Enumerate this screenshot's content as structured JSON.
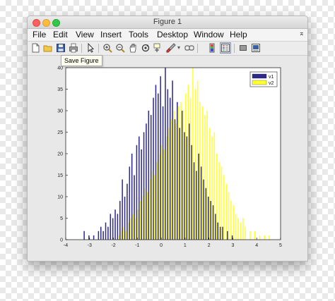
{
  "window": {
    "title": "Figure 1"
  },
  "menu": [
    "File",
    "Edit",
    "View",
    "Insert",
    "Tools",
    "Desktop",
    "Window",
    "Help"
  ],
  "menu_overflow": "⌅",
  "toolbar": {
    "icons": [
      "new-figure-icon",
      "open-file-icon",
      "save-icon",
      "print-icon",
      "pointer-icon",
      "zoom-in-icon",
      "zoom-out-icon",
      "pan-icon",
      "rotate-3d-icon",
      "data-cursor-icon",
      "brush-icon",
      "brush-dropdown-icon",
      "link-plot-icon",
      "insert-colorbar-icon",
      "insert-legend-icon",
      "hide-plot-tools-icon",
      "show-plot-tools-icon"
    ]
  },
  "tooltip": "Save Figure",
  "colors": {
    "v1": "#2d2a8c",
    "v2": "#ffff33"
  },
  "chart_data": {
    "type": "bar",
    "title": "",
    "xlabel": "",
    "ylabel": "",
    "xlim": [
      -4,
      5
    ],
    "ylim": [
      0,
      40
    ],
    "xticks": [
      -4,
      -3,
      -2,
      -1,
      0,
      1,
      2,
      3,
      4,
      5
    ],
    "yticks": [
      0,
      5,
      10,
      15,
      20,
      25,
      30,
      35,
      40
    ],
    "legend_position": "top-right",
    "grid": false,
    "series": [
      {
        "name": "v1",
        "color": "#2d2a8c",
        "x": [
          -3.2,
          -3.0,
          -2.8,
          -2.6,
          -2.5,
          -2.4,
          -2.3,
          -2.2,
          -2.1,
          -2.0,
          -1.9,
          -1.8,
          -1.7,
          -1.6,
          -1.5,
          -1.4,
          -1.3,
          -1.2,
          -1.1,
          -1.0,
          -0.9,
          -0.8,
          -0.7,
          -0.6,
          -0.5,
          -0.4,
          -0.3,
          -0.2,
          -0.1,
          0.0,
          0.1,
          0.2,
          0.3,
          0.4,
          0.5,
          0.6,
          0.7,
          0.8,
          0.9,
          1.0,
          1.1,
          1.2,
          1.3,
          1.4,
          1.5,
          1.6,
          1.7,
          1.8,
          1.9,
          2.0,
          2.1,
          2.2,
          2.3,
          2.4,
          2.5,
          2.6,
          2.8,
          3.0
        ],
        "values": [
          2,
          1,
          1,
          2,
          3,
          2,
          4,
          3,
          6,
          5,
          7,
          6,
          9,
          14,
          10,
          13,
          17,
          20,
          15,
          22,
          24,
          21,
          25,
          27,
          30,
          29,
          33,
          36,
          34,
          38,
          31,
          40,
          35,
          33,
          37,
          28,
          32,
          26,
          30,
          25,
          24,
          27,
          22,
          18,
          16,
          20,
          17,
          14,
          12,
          10,
          9,
          8,
          6,
          4,
          3,
          3,
          2,
          1
        ]
      },
      {
        "name": "v2",
        "color": "#ffff33",
        "x": [
          -1.8,
          -1.7,
          -1.6,
          -1.5,
          -1.4,
          -1.3,
          -1.2,
          -1.1,
          -1.0,
          -0.9,
          -0.8,
          -0.7,
          -0.6,
          -0.5,
          -0.4,
          -0.3,
          -0.2,
          -0.1,
          0.0,
          0.1,
          0.2,
          0.3,
          0.4,
          0.5,
          0.6,
          0.7,
          0.8,
          0.9,
          1.0,
          1.1,
          1.2,
          1.3,
          1.4,
          1.5,
          1.6,
          1.7,
          1.8,
          1.9,
          2.0,
          2.1,
          2.2,
          2.3,
          2.4,
          2.5,
          2.6,
          2.7,
          2.8,
          2.9,
          3.0,
          3.1,
          3.2,
          3.3,
          3.4,
          3.5,
          3.7,
          3.9,
          4.1,
          4.3,
          4.5
        ],
        "values": [
          1,
          2,
          3,
          2,
          4,
          5,
          6,
          5,
          7,
          9,
          10,
          12,
          11,
          14,
          16,
          15,
          18,
          20,
          22,
          21,
          24,
          26,
          28,
          30,
          27,
          31,
          32,
          30,
          34,
          36,
          33,
          40,
          35,
          37,
          32,
          31,
          29,
          30,
          26,
          24,
          25,
          20,
          18,
          17,
          15,
          13,
          11,
          9,
          8,
          6,
          5,
          4,
          5,
          3,
          2,
          2,
          1,
          1,
          1
        ]
      }
    ]
  }
}
